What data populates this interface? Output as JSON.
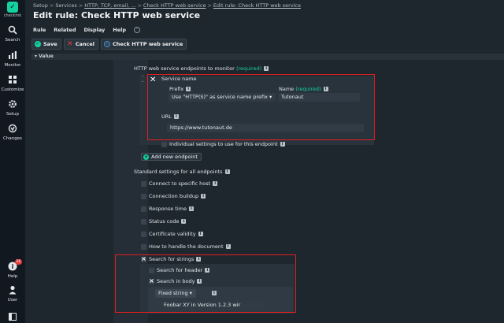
{
  "sidebar": {
    "logo_text": "checkmk",
    "items": [
      {
        "label": "Search"
      },
      {
        "label": "Monitor"
      },
      {
        "label": "Customize"
      },
      {
        "label": "Setup"
      },
      {
        "label": "Changes"
      },
      {
        "label": "Help",
        "badge": "16"
      },
      {
        "label": "User"
      }
    ]
  },
  "breadcrumb": {
    "items": [
      "Setup",
      "Services",
      "HTTP, TCP, email, ...",
      "Check HTTP web service",
      "Edit rule: Check HTTP web service"
    ]
  },
  "page_title": "Edit rule: Check HTTP web service",
  "menubar": {
    "items": [
      "Rule",
      "Related",
      "Display",
      "Help"
    ]
  },
  "toolbar": {
    "save": "Save",
    "cancel": "Cancel",
    "service": "Check HTTP web service"
  },
  "form": {
    "value_header": "Value",
    "endpoints_label": "HTTP web service endpoints to monitor",
    "required": "(required)",
    "service_name_label": "Service name",
    "prefix_label": "Prefix",
    "prefix_value": "Use \"HTTP(S)\" as service name prefix",
    "name_label": "Name",
    "name_value": "Tutonaut",
    "url_label": "URL",
    "url_value": "https://www.tutonaut.de",
    "individual_settings": "Individual settings to use for this endpoint",
    "add_endpoint": "Add new endpoint",
    "standard_settings": "Standard settings for all endpoints",
    "options": [
      "Connect to specific host",
      "Connection buildup",
      "Response time",
      "Status code",
      "Certificate validity",
      "How to handle the document"
    ],
    "search_strings": "Search for strings",
    "search_header": "Search for header",
    "search_body": "Search in body",
    "fixed_string": "Fixed string",
    "body_value": "Foobar XY in Version 1.2.3 wir"
  }
}
